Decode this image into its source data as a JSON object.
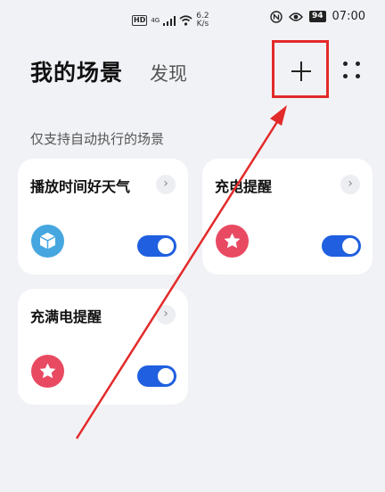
{
  "status_bar": {
    "hd": "HD",
    "signal": "4G",
    "net_speed_value": "6.2",
    "net_speed_unit": "K/s",
    "battery": "94",
    "time": "07:00"
  },
  "header": {
    "title": "我的场景",
    "tab_discover": "发现",
    "add_icon": "plus-icon",
    "more_icon": "four-dots-icon"
  },
  "section": {
    "title": "仅支持自动执行的场景"
  },
  "scenes": [
    {
      "name": "播放时间好天气",
      "icon": "cube-icon",
      "icon_color": "#46a7e0",
      "enabled": true
    },
    {
      "name": "充电提醒",
      "icon": "star-icon",
      "icon_color": "#e84a62",
      "enabled": true
    },
    {
      "name": "充满电提醒",
      "icon": "star-icon",
      "icon_color": "#e84a62",
      "enabled": true
    }
  ],
  "colors": {
    "background": "#f1f2f6",
    "toggle_on": "#1f5fe0",
    "annotation": "#e32a2a"
  }
}
